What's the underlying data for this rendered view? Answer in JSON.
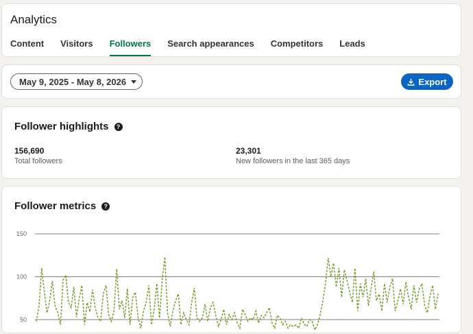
{
  "header": {
    "title": "Analytics",
    "tabs": [
      {
        "label": "Content",
        "active": false
      },
      {
        "label": "Visitors",
        "active": false
      },
      {
        "label": "Followers",
        "active": true
      },
      {
        "label": "Search appearances",
        "active": false
      },
      {
        "label": "Competitors",
        "active": false
      },
      {
        "label": "Leads",
        "active": false
      }
    ]
  },
  "filter": {
    "date_range": "May 9, 2025 - May 8, 2026",
    "export_label": "Export",
    "export_color": "#0a66c2"
  },
  "highlights": {
    "title": "Follower highlights",
    "help_icon": "question-circle-icon",
    "total_followers": {
      "value": "156,690",
      "label": "Total followers"
    },
    "new_followers": {
      "value": "23,301",
      "label": "New followers in the last 365 days"
    }
  },
  "metrics": {
    "title": "Follower metrics",
    "help_icon": "question-circle-icon"
  },
  "chart_data": {
    "type": "line",
    "line_color": "#7a9a2e",
    "line_style": "dashed",
    "yticks": [
      150,
      100,
      50
    ],
    "ylim": [
      0,
      150
    ],
    "grid": true,
    "series": [
      {
        "values": [
          48,
          66,
          110,
          82,
          58,
          72,
          95,
          66,
          58,
          44,
          96,
          102,
          70,
          64,
          88,
          53,
          74,
          90,
          44,
          70,
          59,
          85,
          64,
          52,
          48,
          80,
          90,
          56,
          48,
          60,
          109,
          62,
          72,
          52,
          86,
          44,
          76,
          82,
          52,
          40,
          60,
          70,
          90,
          44,
          62,
          92,
          52,
          96,
          123,
          58,
          42,
          60,
          72,
          80,
          44,
          58,
          50,
          44,
          70,
          87,
          52,
          48,
          52,
          68,
          48,
          64,
          70,
          55,
          42,
          50,
          62,
          44,
          56,
          50,
          58,
          46,
          40,
          62,
          56,
          48,
          52,
          50,
          60,
          46,
          55,
          52,
          58,
          64,
          46,
          40,
          55,
          52,
          44,
          48,
          40,
          44,
          42,
          44,
          40,
          52,
          45,
          42,
          50,
          48,
          38,
          44,
          56,
          72,
          92,
          122,
          100,
          116,
          88,
          110,
          76,
          108,
          96,
          82,
          70,
          110,
          60,
          92,
          76,
          98,
          66,
          86,
          106,
          72,
          80,
          60,
          92,
          70,
          88,
          98,
          60,
          72,
          86,
          68,
          94,
          76,
          62,
          90,
          70,
          86,
          92,
          66,
          58,
          78,
          90,
          62,
          80
        ]
      }
    ]
  }
}
